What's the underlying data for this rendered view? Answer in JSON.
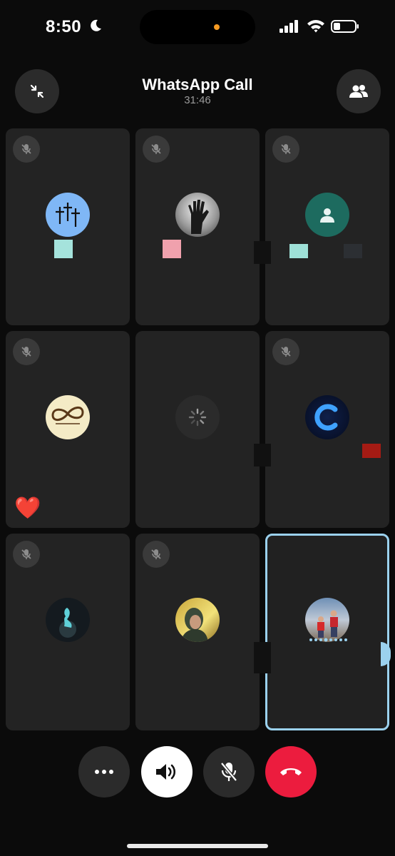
{
  "status_bar": {
    "time": "8:50"
  },
  "header": {
    "title": "WhatsApp Call",
    "duration": "31:46"
  },
  "tiles": [
    {
      "name": "participant-1",
      "muted": true
    },
    {
      "name": "participant-2",
      "muted": true
    },
    {
      "name": "participant-3",
      "muted": true
    },
    {
      "name": "participant-4",
      "muted": true,
      "reaction": "❤️"
    },
    {
      "name": "participant-5",
      "muted": false,
      "state": "connecting"
    },
    {
      "name": "participant-6",
      "muted": true
    },
    {
      "name": "participant-7",
      "muted": true
    },
    {
      "name": "participant-8",
      "muted": true
    },
    {
      "name": "participant-9",
      "muted": false,
      "active": true
    }
  ],
  "reaction": "❤️",
  "colors": {
    "accent_active_border": "#9bd1ee",
    "end_call": "#ec1c3e",
    "island_dot": "#f59a22"
  },
  "controls": [
    {
      "name": "more-options",
      "icon": "ellipsis-icon"
    },
    {
      "name": "speaker",
      "icon": "speaker-icon"
    },
    {
      "name": "mute",
      "icon": "mic-off-icon"
    },
    {
      "name": "end-call",
      "icon": "phone-hangup-icon"
    }
  ]
}
